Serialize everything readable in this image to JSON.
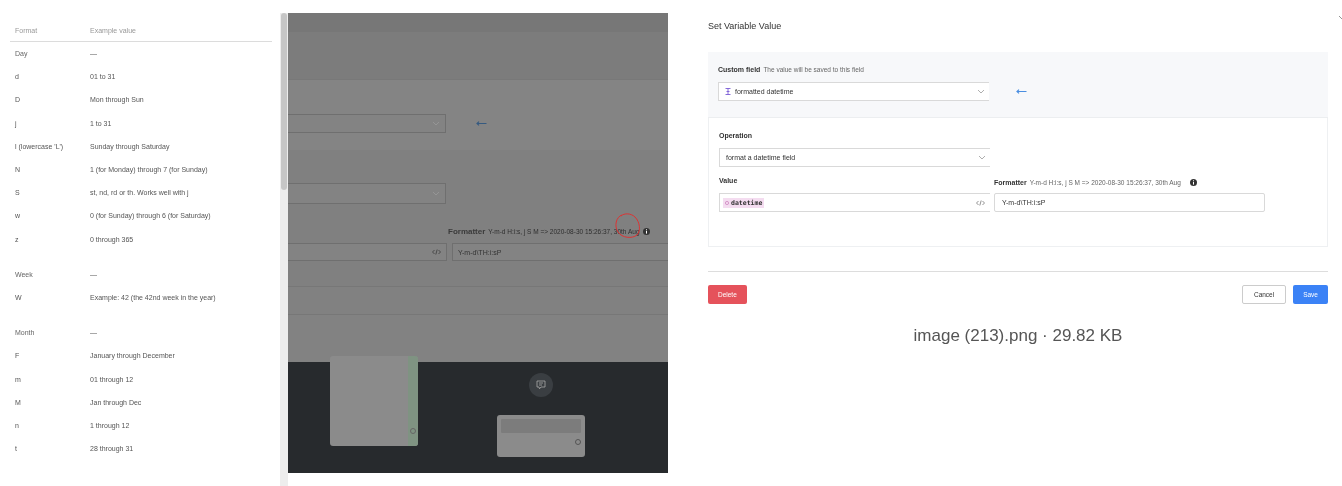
{
  "format_table": {
    "columns": [
      "Format",
      "Example value"
    ],
    "groups": [
      {
        "name": "Day",
        "example": "—",
        "rows": [
          {
            "format": "d",
            "example": "01 to 31"
          },
          {
            "format": "D",
            "example": "Mon through Sun"
          },
          {
            "format": "j",
            "example": "1 to 31"
          },
          {
            "format": "l (lowercase 'L')",
            "example": "Sunday through Saturday"
          },
          {
            "format": "N",
            "example": "1 (for Monday) through 7 (for Sunday)"
          },
          {
            "format": "S",
            "example": "st, nd, rd or th. Works well with j"
          },
          {
            "format": "w",
            "example": "0 (for Sunday) through 6 (for Saturday)"
          },
          {
            "format": "z",
            "example": "0 through 365"
          }
        ]
      },
      {
        "name": "Week",
        "example": "—",
        "rows": [
          {
            "format": "W",
            "example": "Example: 42 (the 42nd week in the year)"
          }
        ]
      },
      {
        "name": "Month",
        "example": "—",
        "rows": [
          {
            "format": "F",
            "example": "January through December"
          },
          {
            "format": "m",
            "example": "01 through 12"
          },
          {
            "format": "M",
            "example": "Jan through Dec"
          },
          {
            "format": "n",
            "example": "1 through 12"
          },
          {
            "format": "t",
            "example": "28 through 31"
          }
        ]
      }
    ]
  },
  "background_screenshot": {
    "formatter": {
      "label": "Formatter",
      "hint": "Y-m-d H:i:s, j S M => 2020-08-30 15:26:37, 30th Aug",
      "value": "Y-m-d\\TH:i:sP"
    }
  },
  "dialog": {
    "title": "Set Variable Value",
    "custom_field": {
      "label": "Custom field",
      "hint": "The value will be saved to this field",
      "value": "formatted datetime"
    },
    "operation": {
      "label": "Operation",
      "value": "format a datetime field"
    },
    "value": {
      "label": "Value",
      "tag": "datetime"
    },
    "formatter": {
      "label": "Formatter",
      "hint": "Y-m-d H:i:s, j S M => 2020-08-30 15:26:37, 30th Aug",
      "value": "Y-m-d\\TH:i:sP"
    },
    "buttons": [
      {
        "label": "Delete",
        "kind": "danger"
      },
      {
        "label": "Cancel",
        "kind": "secondary"
      },
      {
        "label": "Save",
        "kind": "primary"
      }
    ]
  },
  "caption": "image (213).png · 29.82 KB"
}
